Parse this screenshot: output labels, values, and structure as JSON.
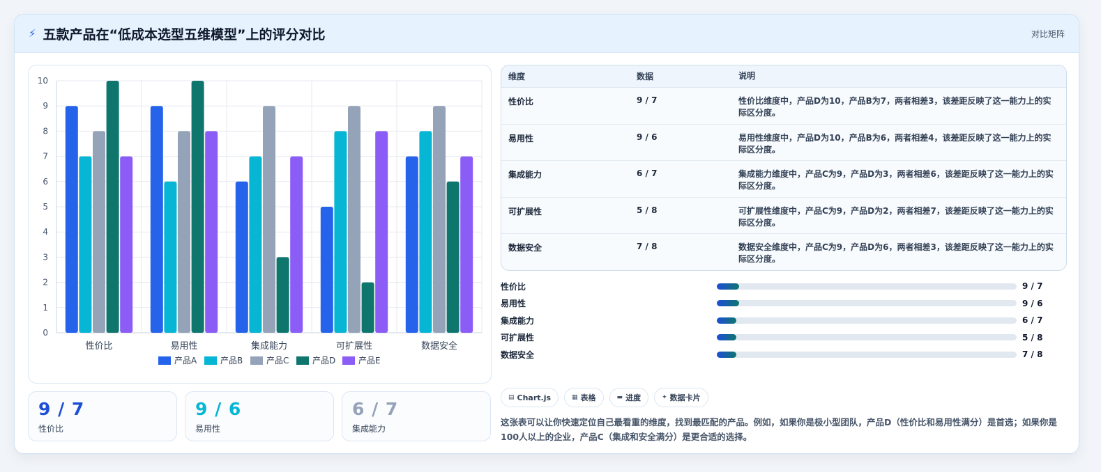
{
  "header": {
    "icon": "bolt-icon",
    "title": "五款产品在“低成本选型五维模型”上的评分对比",
    "tag": "对比矩阵"
  },
  "chart_data": {
    "type": "bar",
    "categories": [
      "性价比",
      "易用性",
      "集成能力",
      "可扩展性",
      "数据安全"
    ],
    "series": [
      {
        "name": "产品A",
        "color": "#2563eb",
        "values": [
          9,
          9,
          6,
          5,
          7
        ]
      },
      {
        "name": "产品B",
        "color": "#06b6d4",
        "values": [
          7,
          6,
          7,
          8,
          8
        ]
      },
      {
        "name": "产品C",
        "color": "#94a3b8",
        "values": [
          8,
          8,
          9,
          9,
          9
        ]
      },
      {
        "name": "产品D",
        "color": "#0f766e",
        "values": [
          10,
          10,
          3,
          2,
          6
        ]
      },
      {
        "name": "产品E",
        "color": "#8b5cf6",
        "values": [
          7,
          8,
          7,
          8,
          7
        ]
      }
    ],
    "yticks": [
      0,
      1,
      2,
      3,
      4,
      5,
      6,
      7,
      8,
      9,
      10
    ],
    "ylim": [
      0,
      10
    ],
    "grid": true,
    "legend": "bottom-center"
  },
  "stats": [
    {
      "value": "9 / 7",
      "label": "性价比",
      "color": "#1d4ed8"
    },
    {
      "value": "9 / 6",
      "label": "易用性",
      "color": "#06b6d4"
    },
    {
      "value": "6 / 7",
      "label": "集成能力",
      "color": "#94a3b8"
    }
  ],
  "table": {
    "headers": [
      "维度",
      "数据",
      "说明"
    ],
    "rows": [
      {
        "dim": "性价比",
        "data": "9 / 7",
        "desc": "性价比维度中，产品D为10，产品B为7，两者相差3，该差距反映了这一能力上的实际区分度。"
      },
      {
        "dim": "易用性",
        "data": "9 / 6",
        "desc": "易用性维度中，产品D为10，产品B为6，两者相差4，该差距反映了这一能力上的实际区分度。"
      },
      {
        "dim": "集成能力",
        "data": "6 / 7",
        "desc": "集成能力维度中，产品C为9，产品D为3，两者相差6，该差距反映了这一能力上的实际区分度。"
      },
      {
        "dim": "可扩展性",
        "data": "5 / 8",
        "desc": "可扩展性维度中，产品C为9，产品D为2，两者相差7，该差距反映了这一能力上的实际区分度。"
      },
      {
        "dim": "数据安全",
        "data": "7 / 8",
        "desc": "数据安全维度中，产品C为9，产品D为6，两者相差3，该差距反映了这一能力上的实际区分度。"
      }
    ]
  },
  "progress": [
    {
      "label": "性价比",
      "value": "9 / 7",
      "fill_percent": 7.5
    },
    {
      "label": "易用性",
      "value": "9 / 6",
      "fill_percent": 7.5
    },
    {
      "label": "集成能力",
      "value": "6 / 7",
      "fill_percent": 6.5
    },
    {
      "label": "可扩展性",
      "value": "5 / 8",
      "fill_percent": 6.5
    },
    {
      "label": "数据安全",
      "value": "7 / 8",
      "fill_percent": 6.5
    }
  ],
  "chips": [
    {
      "icon": "chart-icon",
      "glyph": "▤",
      "label": "Chart.js"
    },
    {
      "icon": "table-icon",
      "glyph": "▦",
      "label": "表格"
    },
    {
      "icon": "progress-icon",
      "glyph": "▬",
      "label": "进度"
    },
    {
      "icon": "card-icon",
      "glyph": "✦",
      "label": "数据卡片"
    }
  ],
  "note": "这张表可以让你快速定位自己最看重的维度，找到最匹配的产品。例如，如果你是极小型团队，产品D（性价比和易用性满分）是首选；如果你是100人以上的企业，产品C（集成和安全满分）是更合适的选择。"
}
